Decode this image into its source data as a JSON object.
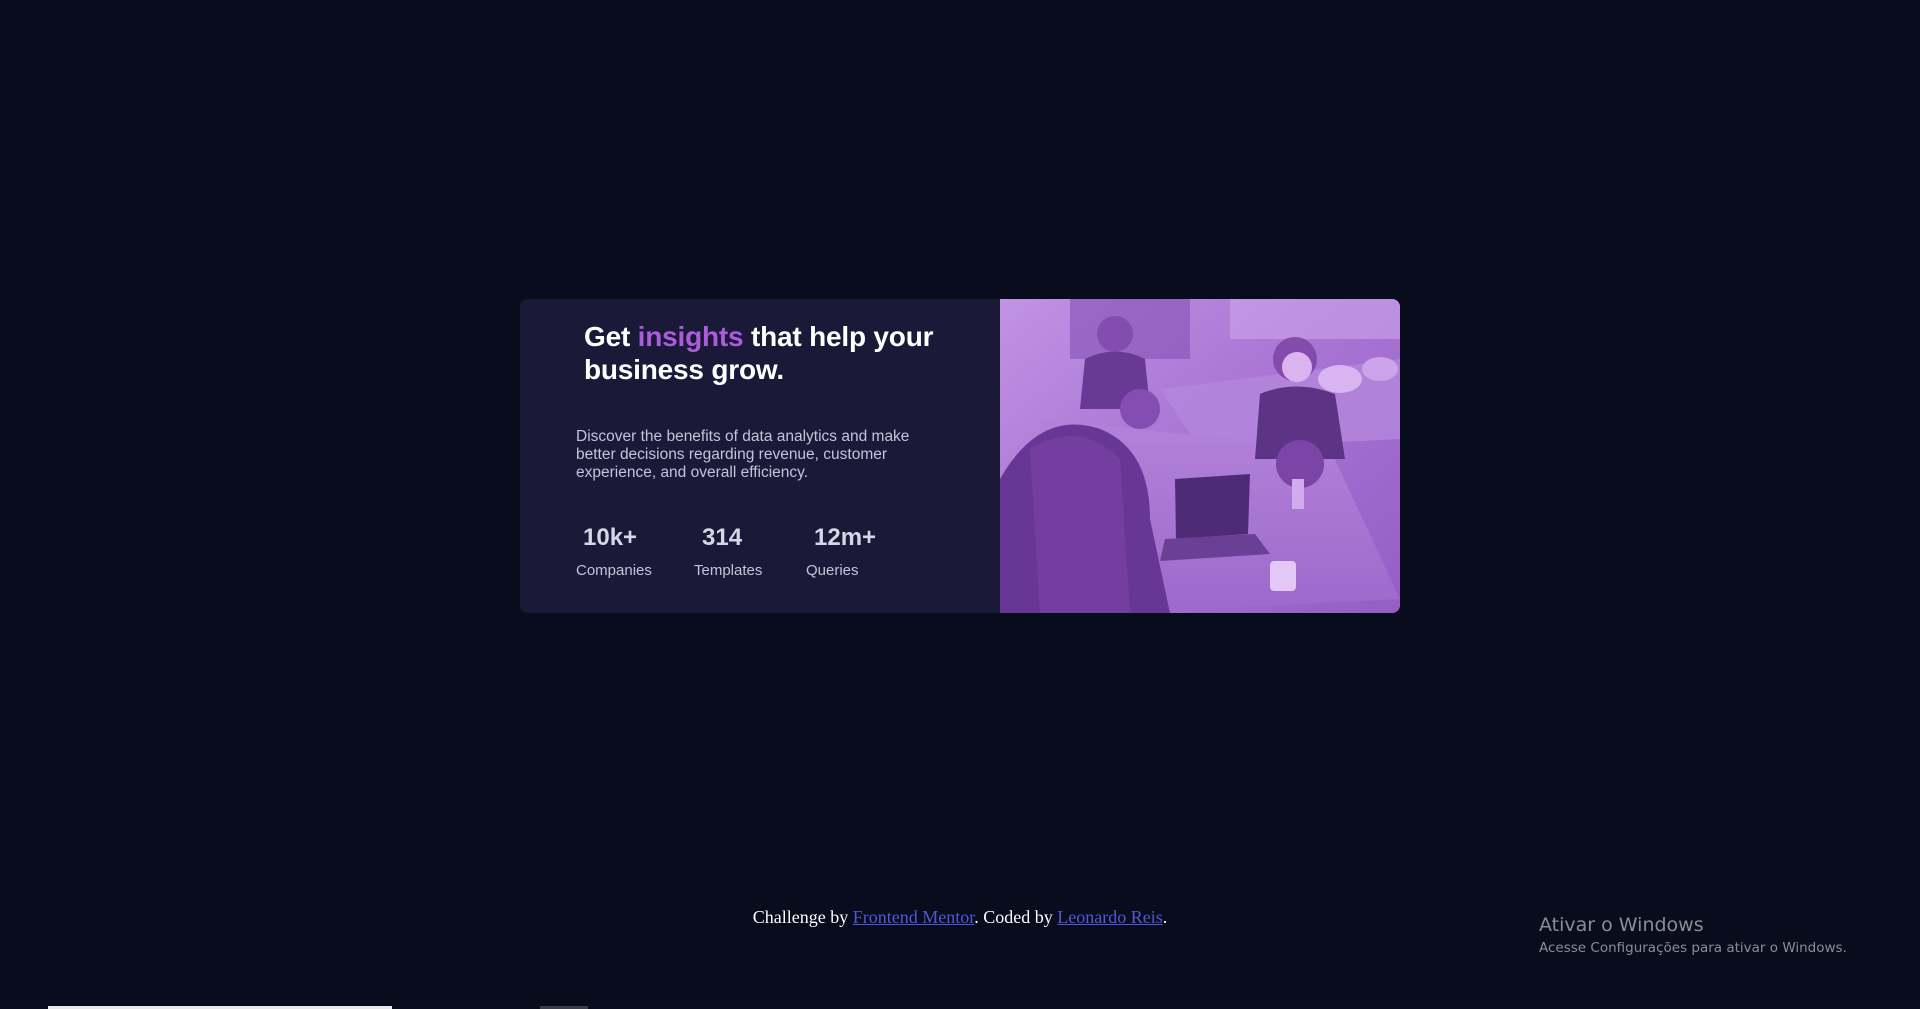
{
  "card": {
    "headline": {
      "before": "Get ",
      "accent": "insights",
      "after": " that help your business grow."
    },
    "description": "Discover the benefits of data analytics and make better decisions regarding revenue, customer experience, and overall efficiency.",
    "stats": [
      {
        "value": "10k+",
        "label": "Companies"
      },
      {
        "value": "314",
        "label": "Templates"
      },
      {
        "value": "12m+",
        "label": "Queries"
      }
    ],
    "image_description": "purple-tinted office photo"
  },
  "footer": {
    "prefix": "Challenge by ",
    "link1": "Frontend Mentor",
    "middle": ". Coded by ",
    "link2": "Leonardo Reis",
    "suffix": "."
  },
  "windows": {
    "title": "Ativar o Windows",
    "subtitle": "Acesse Configurações para ativar o Windows."
  },
  "colors": {
    "background": "#090c1d",
    "card": "#1b1938",
    "accent": "#ab5cdb",
    "image_overlay": "#aa5cdb"
  }
}
